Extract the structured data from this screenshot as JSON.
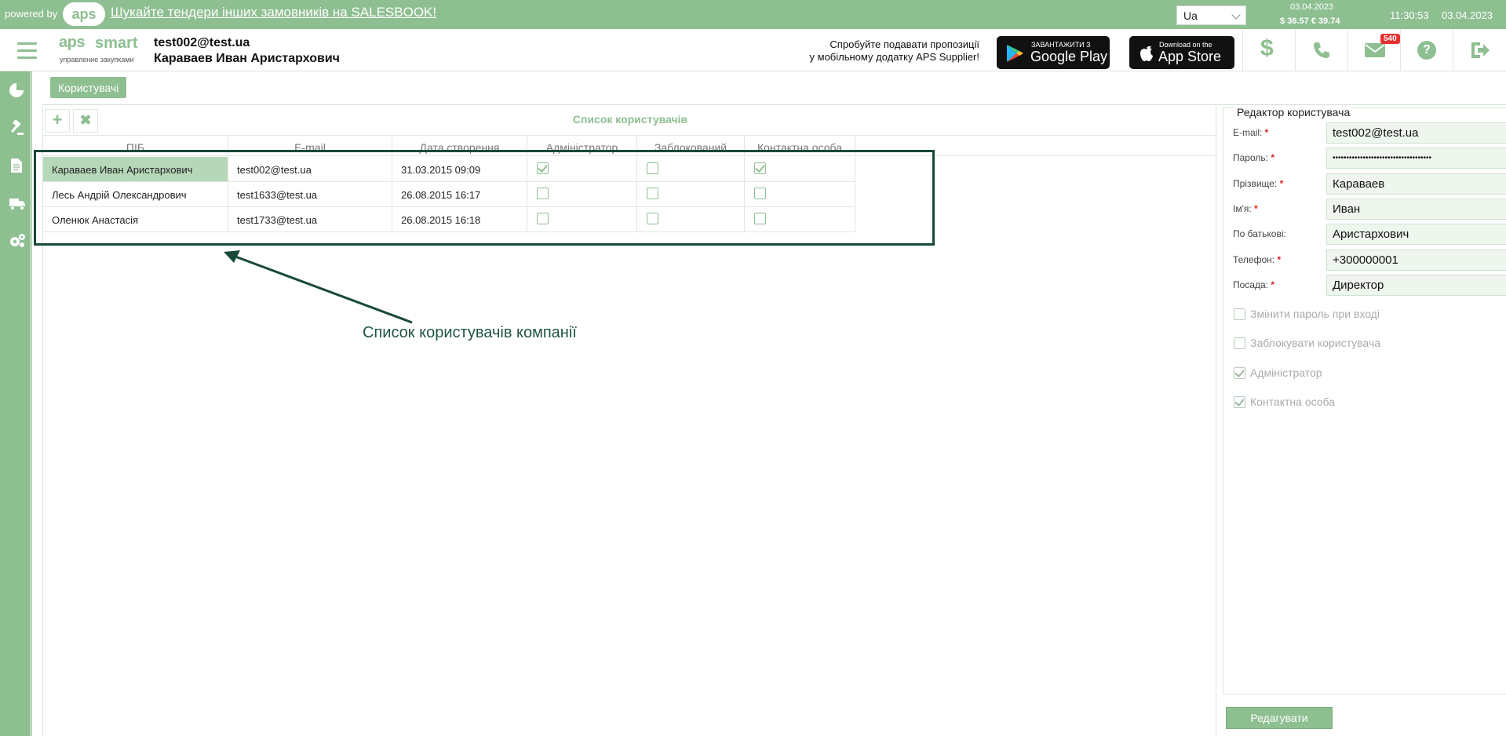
{
  "topbar": {
    "powered_by": "powered by",
    "logo_text": "aps",
    "promo_link": "Шукайте тендери інших замовників на SALESBOOK!",
    "language": "Ua",
    "rate_date": "03.04.2023",
    "rates": "$ 36.57  € 39.74",
    "time": "11:30:53",
    "date": "03.04.2023"
  },
  "header": {
    "brand_aps": "aps",
    "brand_smart": "smart",
    "brand_sub": "управление закупками",
    "user_email": "test002@test.ua",
    "user_name": "Караваев Иван Аристархович",
    "mobile_promo_line1": "Спробуйте подавати пропозиції",
    "mobile_promo_line2": "у мобільному додатку APS Supplier!",
    "google_play_small": "ЗАВАНТАЖИТИ З",
    "google_play_big": "Google Play",
    "app_store_small": "Download on the",
    "app_store_big": "App Store",
    "messages_badge": "540"
  },
  "tabs": [
    {
      "label": "Користувачі"
    }
  ],
  "grid": {
    "title": "Список користувачів",
    "columns": [
      "ПІБ",
      "E-mail",
      "Дата створення",
      "Адміністратор",
      "Заблокований",
      "Контактна особа"
    ],
    "rows": [
      {
        "name": "Караваев Иван Аристархович",
        "email": "test002@test.ua",
        "created": "31.03.2015 09:09",
        "admin": true,
        "blocked": false,
        "contact": true,
        "selected": true
      },
      {
        "name": "Лесь Андрій Олександрович",
        "email": "test1633@test.ua",
        "created": "26.08.2015 16:17",
        "admin": false,
        "blocked": false,
        "contact": false,
        "selected": false
      },
      {
        "name": "Оленюк Анастасія",
        "email": "test1733@test.ua",
        "created": "26.08.2015 16:18",
        "admin": false,
        "blocked": false,
        "contact": false,
        "selected": false
      }
    ]
  },
  "annotation": {
    "text": "Список користувачів компанії"
  },
  "editor": {
    "legend": "Редактор користувача",
    "fields": [
      {
        "label": "E-mail:",
        "required": true,
        "value": "test002@test.ua"
      },
      {
        "label": "Пароль:",
        "required": true,
        "value": "••••••••••••••••••••••••••••••••••••"
      },
      {
        "label": "Прізвище:",
        "required": true,
        "value": "Караваев"
      },
      {
        "label": "Ім'я:",
        "required": true,
        "value": "Иван"
      },
      {
        "label": "По батькові:",
        "required": false,
        "value": "Аристархович"
      },
      {
        "label": "Телефон:",
        "required": true,
        "value": "+300000001"
      },
      {
        "label": "Посада:",
        "required": true,
        "value": "Директор"
      }
    ],
    "checks": [
      {
        "label": "Змінити пароль при вході",
        "checked": false
      },
      {
        "label": "Заблокувати користувача",
        "checked": false
      },
      {
        "label": "Адміністратор",
        "checked": true
      },
      {
        "label": "Контактна особа",
        "checked": true
      }
    ],
    "edit_button": "Редагувати"
  },
  "colors": {
    "accent": "#8ebf91",
    "annotation": "#18493a",
    "badge": "#e8302f"
  }
}
